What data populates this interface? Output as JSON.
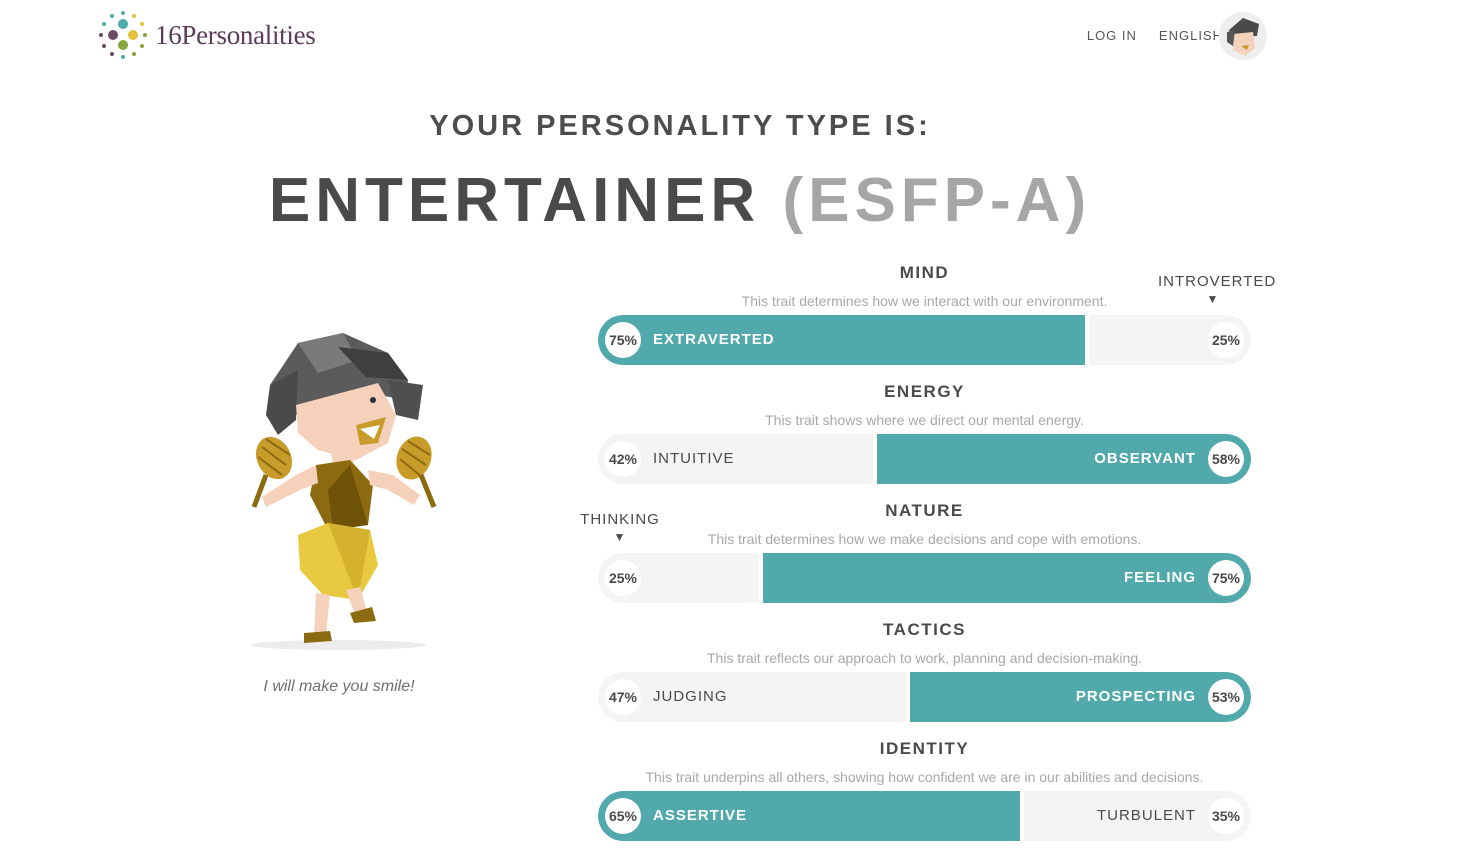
{
  "header": {
    "logo_text": "16Personalities",
    "login_label": "LOG IN",
    "language_label": "ENGLISH"
  },
  "result": {
    "subtitle": "YOUR PERSONALITY TYPE IS:",
    "type_name": "ENTERTAINER",
    "type_code": "(ESFP-A)",
    "tagline": "I will make you smile!"
  },
  "traits": [
    {
      "name": "MIND",
      "description": "This trait determines how we interact with our environment.",
      "left_label": "EXTRAVERTED",
      "left_pct": "75%",
      "right_label": "",
      "right_pct": "25%",
      "dominant": "left",
      "value": 75,
      "marker": "INTROVERTED"
    },
    {
      "name": "ENERGY",
      "description": "This trait shows where we direct our mental energy.",
      "left_label": "INTUITIVE",
      "left_pct": "42%",
      "right_label": "OBSERVANT",
      "right_pct": "58%",
      "dominant": "right",
      "value": 58,
      "marker": ""
    },
    {
      "name": "NATURE",
      "description": "This trait determines how we make decisions and cope with emotions.",
      "left_label": "",
      "left_pct": "25%",
      "right_label": "FEELING",
      "right_pct": "75%",
      "dominant": "right",
      "value": 75,
      "marker": "THINKING"
    },
    {
      "name": "TACTICS",
      "description": "This trait reflects our approach to work, planning and decision-making.",
      "left_label": "JUDGING",
      "left_pct": "47%",
      "right_label": "PROSPECTING",
      "right_pct": "53%",
      "dominant": "right",
      "value": 53,
      "marker": ""
    },
    {
      "name": "IDENTITY",
      "description": "This trait underpins all others, showing how confident we are in our abilities and decisions.",
      "left_label": "ASSERTIVE",
      "left_pct": "65%",
      "right_label": "TURBULENT",
      "right_pct": "35%",
      "dominant": "left",
      "value": 65,
      "marker": ""
    }
  ],
  "colors": {
    "accent": "#51a9ab",
    "track": "#f4f4f4",
    "brand": "#5d3b5c"
  },
  "icons": {
    "language": "globe-icon",
    "logo": "logo-dots-icon"
  }
}
